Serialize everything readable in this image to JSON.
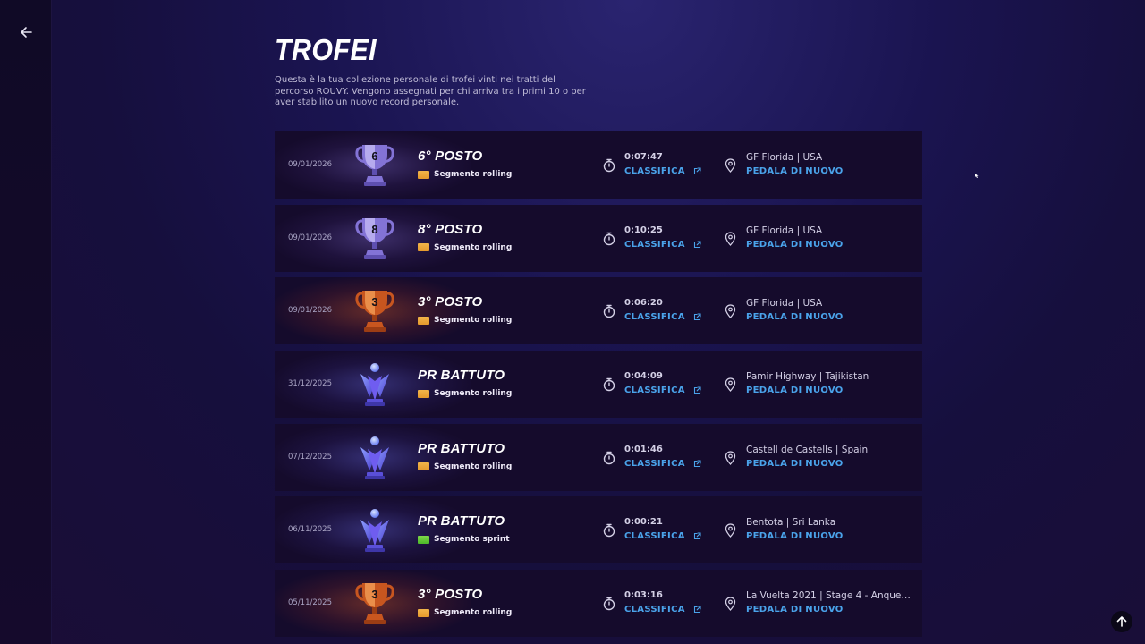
{
  "sidebar": {
    "back_icon": "arrow-left-icon"
  },
  "header": {
    "title": "TROFEI",
    "description": "Questa è la tua collezione personale di trofei vinti nei tratti del percorso ROUVY. Vengono assegnati per chi arriva tra i primi 10 o per aver stabilito un nuovo record personale."
  },
  "colors": {
    "accent_link": "#4aa3ea",
    "rolling": "#e9a23a",
    "sprint": "#5cc832",
    "bronze": "#e07a2c",
    "silver": "#9b8ee0",
    "pr_blue": "#5a5ee6"
  },
  "trophies": [
    {
      "date": "09/01/2026",
      "type": "silver",
      "number": "6",
      "rank": "6° POSTO",
      "segment": "Segmento rolling",
      "segment_kind": "rolling",
      "time": "0:07:47",
      "classifica": "CLASSIFICA",
      "location": "GF Florida | USA",
      "pedala": "PEDALA DI NUOVO"
    },
    {
      "date": "09/01/2026",
      "type": "silver",
      "number": "8",
      "rank": "8° POSTO",
      "segment": "Segmento rolling",
      "segment_kind": "rolling",
      "time": "0:10:25",
      "classifica": "CLASSIFICA",
      "location": "GF Florida | USA",
      "pedala": "PEDALA DI NUOVO"
    },
    {
      "date": "09/01/2026",
      "type": "bronze",
      "number": "3",
      "rank": "3° POSTO",
      "segment": "Segmento rolling",
      "segment_kind": "rolling",
      "time": "0:06:20",
      "classifica": "CLASSIFICA",
      "location": "GF Florida | USA",
      "pedala": "PEDALA DI NUOVO"
    },
    {
      "date": "31/12/2025",
      "type": "pr",
      "number": "",
      "rank": "PR BATTUTO",
      "segment": "Segmento rolling",
      "segment_kind": "rolling",
      "time": "0:04:09",
      "classifica": "CLASSIFICA",
      "location": "Pamir Highway | Tajikistan",
      "pedala": "PEDALA DI NUOVO"
    },
    {
      "date": "07/12/2025",
      "type": "pr",
      "number": "",
      "rank": "PR BATTUTO",
      "segment": "Segmento rolling",
      "segment_kind": "rolling",
      "time": "0:01:46",
      "classifica": "CLASSIFICA",
      "location": "Castell de Castells | Spain",
      "pedala": "PEDALA DI NUOVO"
    },
    {
      "date": "06/11/2025",
      "type": "pr",
      "number": "",
      "rank": "PR BATTUTO",
      "segment": "Segmento sprint",
      "segment_kind": "sprint",
      "time": "0:00:21",
      "classifica": "CLASSIFICA",
      "location": "Bentota | Sri Lanka",
      "pedala": "PEDALA DI NUOVO"
    },
    {
      "date": "05/11/2025",
      "type": "bronze",
      "number": "3",
      "rank": "3° POSTO",
      "segment": "Segmento rolling",
      "segment_kind": "rolling",
      "time": "0:03:16",
      "classifica": "CLASSIFICA",
      "location": "La Vuelta 2021 | Stage 4 - Anquel...",
      "pedala": "PEDALA DI NUOVO"
    }
  ],
  "scroll_top_icon": "arrow-up-icon"
}
